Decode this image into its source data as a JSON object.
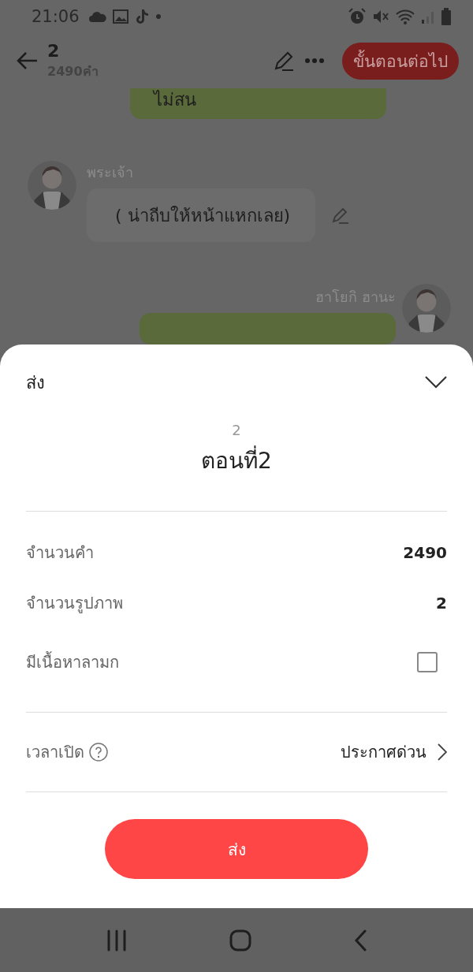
{
  "status_bar": {
    "time": "21:06"
  },
  "header": {
    "title": "2",
    "subtitle": "2490คำ",
    "next_button": "ขั้นตอนต่อไป"
  },
  "messages": [
    {
      "kind": "outgoing",
      "text": "ไม่สน"
    },
    {
      "kind": "incoming",
      "name": "พระเจ้า",
      "text": "( น่าถีบให้หน้าแหกเลย)",
      "editable": true
    },
    {
      "kind": "outgoing",
      "name": "ฮาโยกิ ฮานะ"
    }
  ],
  "sheet": {
    "title": "ส่ง",
    "episode_number": "2",
    "episode_title": "ตอนที่2",
    "stats": [
      {
        "label": "จำนวนคำ",
        "value": "2490"
      },
      {
        "label": "จำนวนรูปภาพ",
        "value": "2"
      }
    ],
    "mature": {
      "label": "มีเนื้อหาลามก",
      "checked": false
    },
    "publish_time": {
      "label": "เวลาเปิด",
      "value": "ประกาศด่วน"
    },
    "submit_button": "ส่ง"
  }
}
